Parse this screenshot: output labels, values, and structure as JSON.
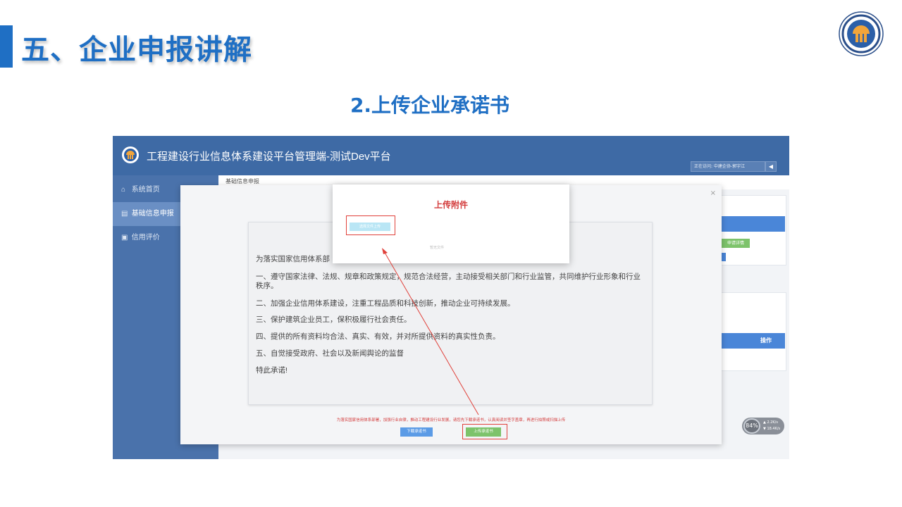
{
  "slide": {
    "title": "五、企业申报讲解",
    "subtitle": "2.上传企业承诺书"
  },
  "app": {
    "title": "工程建设行业信息体系建设平台管理端-测试Dev平台",
    "user_text": "正在访问: 中建企协-郭宇江",
    "user_icon": "back-arrow-icon"
  },
  "sidebar": {
    "items": [
      {
        "label": "系统首页",
        "icon": "home-icon"
      },
      {
        "label": "基础信息申报",
        "icon": "document-icon"
      },
      {
        "label": "信用评价",
        "icon": "star-doc-icon"
      }
    ]
  },
  "content": {
    "breadcrumb": "基础信息申报"
  },
  "background": {
    "green_button": "申请详情",
    "operation_header": "操作"
  },
  "upload_dialog": {
    "title": "上传附件",
    "select_button": "选择文件上传",
    "hint": "暂无文件"
  },
  "letter": {
    "intro": "为落实国家信用体系部",
    "items": [
      "一、遵守国家法律、法规、规章和政策规定，规范合法经营，主动接受相关部门和行业监管，共同维护行业形象和行业秩序。",
      "二、加强企业信用体系建设，注重工程品质和科技创新，推动企业可持续发展。",
      "三、保护建筑企业员工，保积极履行社会责任。",
      "四、提供的所有资料均合法、真实、有效，并对所提供资料的真实性负责。",
      "五、自觉接受政府、社会以及新闻舆论的监督",
      "特此承诺!"
    ]
  },
  "modal": {
    "notice": "为落实国家信用体系部署，加强行业自律，推动工程建设行业发展，请您先下载承诺书，认真阅读并签字盖章，再进行拍照或扫描上传",
    "download_button": "下载承诺书",
    "upload_button": "上传承诺书",
    "close_icon": "close-icon"
  },
  "network": {
    "percent": "84%",
    "up": "2.2K/s",
    "down": "18.4K/s"
  },
  "colors": {
    "brand_blue": "#1f6fc4",
    "topbar": "#3e6aa5",
    "sidebar": "#4a72ab",
    "highlight_red": "#e0413a",
    "green": "#7dc36b"
  }
}
